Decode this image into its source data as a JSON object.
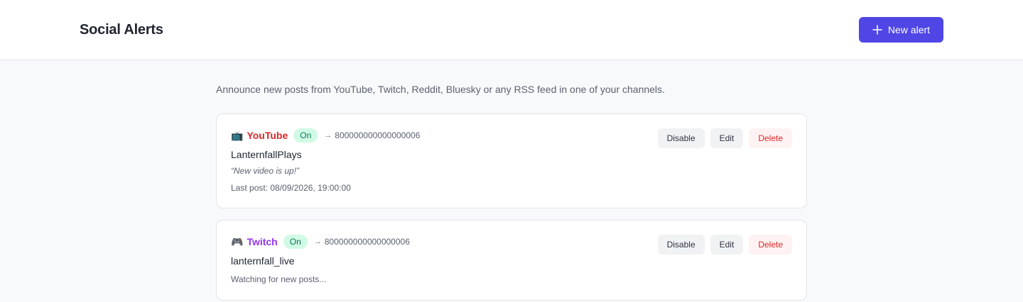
{
  "header": {
    "title": "Social Alerts",
    "new_alert_label": "New alert",
    "accent": "#4f46e5"
  },
  "intro": "Announce new posts from YouTube, Twitch, Reddit, Bluesky or any RSS feed in one of your channels.",
  "alerts": [
    {
      "platform_icon": "📺",
      "platform": "YouTube",
      "platform_color": "#dc2626",
      "status": "On",
      "arrow": "→",
      "channel_id": "800000000000000006",
      "account": "LanternfallPlays",
      "message": "“New video is up!”",
      "meta": "Last post: 08/09/2026, 19:00:00",
      "actions": {
        "disable": "Disable",
        "edit": "Edit",
        "delete": "Delete"
      }
    },
    {
      "platform_icon": "🎮",
      "platform": "Twitch",
      "platform_color": "#9333ea",
      "status": "On",
      "arrow": "→",
      "channel_id": "800000000000000006",
      "account": "lanternfall_live",
      "meta": "Watching for new posts...",
      "actions": {
        "disable": "Disable",
        "edit": "Edit",
        "delete": "Delete"
      }
    }
  ]
}
